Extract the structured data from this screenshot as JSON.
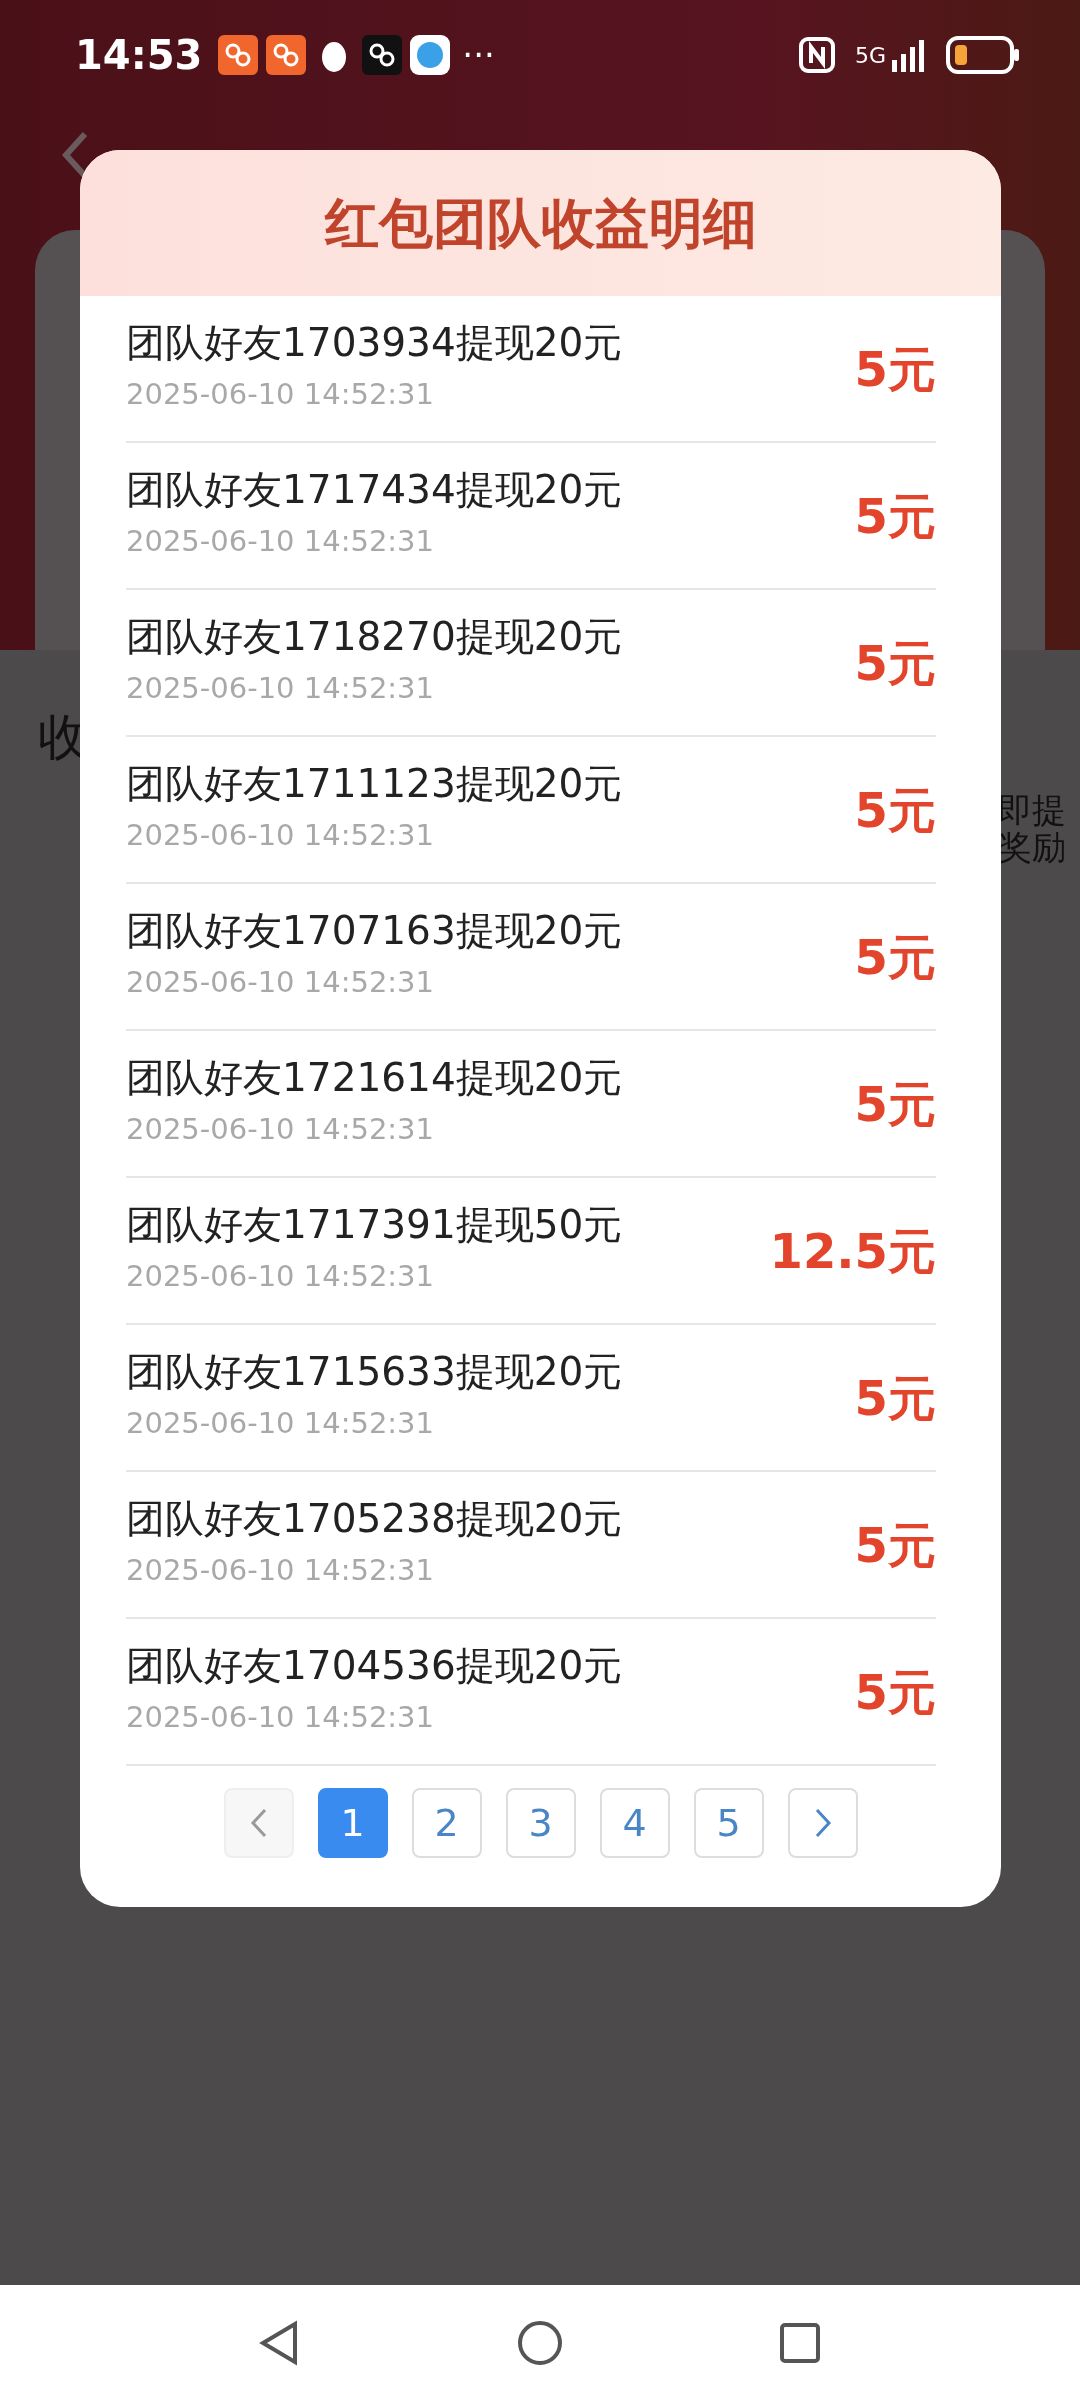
{
  "status_bar": {
    "time": "14:53",
    "more": "···",
    "network": "5G"
  },
  "background": {
    "side_label": "收",
    "right_lines": [
      "即提",
      "奖励"
    ]
  },
  "dialog": {
    "title": "红包团队收益明细",
    "items": [
      {
        "text": "团队好友1703934提现20元",
        "time": "2025-06-10 14:52:31",
        "amount": "5元"
      },
      {
        "text": "团队好友1717434提现20元",
        "time": "2025-06-10 14:52:31",
        "amount": "5元"
      },
      {
        "text": "团队好友1718270提现20元",
        "time": "2025-06-10 14:52:31",
        "amount": "5元"
      },
      {
        "text": "团队好友1711123提现20元",
        "time": "2025-06-10 14:52:31",
        "amount": "5元"
      },
      {
        "text": "团队好友1707163提现20元",
        "time": "2025-06-10 14:52:31",
        "amount": "5元"
      },
      {
        "text": "团队好友1721614提现20元",
        "time": "2025-06-10 14:52:31",
        "amount": "5元"
      },
      {
        "text": "团队好友1717391提现50元",
        "time": "2025-06-10 14:52:31",
        "amount": "12.5元"
      },
      {
        "text": "团队好友1715633提现20元",
        "time": "2025-06-10 14:52:31",
        "amount": "5元"
      },
      {
        "text": "团队好友1705238提现20元",
        "time": "2025-06-10 14:52:31",
        "amount": "5元"
      },
      {
        "text": "团队好友1704536提现20元",
        "time": "2025-06-10 14:52:31",
        "amount": "5元"
      }
    ],
    "pagination": {
      "prev_disabled": true,
      "pages": [
        {
          "label": "1",
          "selected": true
        },
        {
          "label": "2",
          "selected": false
        },
        {
          "label": "3",
          "selected": false
        },
        {
          "label": "4",
          "selected": false
        },
        {
          "label": "5",
          "selected": false
        }
      ]
    }
  }
}
